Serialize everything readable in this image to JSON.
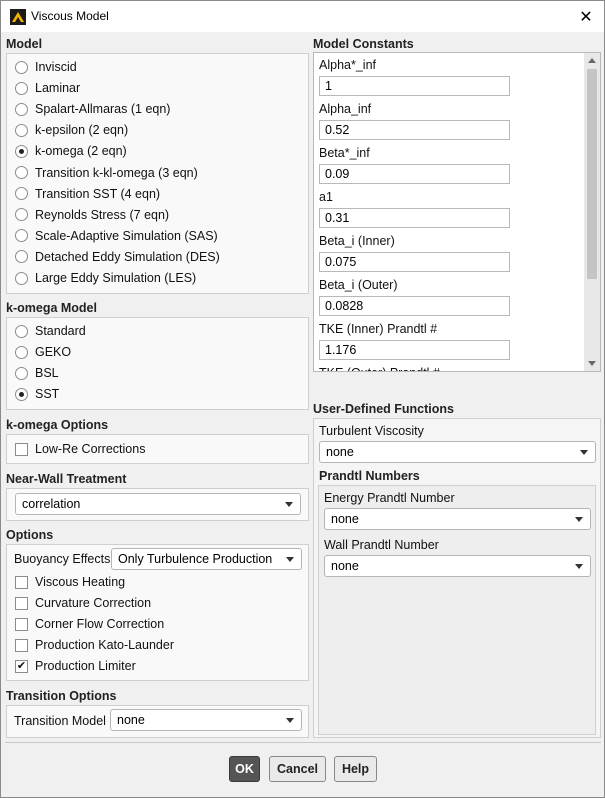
{
  "window": {
    "title": "Viscous Model",
    "close_glyph": "✕",
    "icon": "app-icon"
  },
  "model": {
    "title": "Model",
    "options": [
      {
        "label": "Inviscid",
        "selected": false
      },
      {
        "label": "Laminar",
        "selected": false
      },
      {
        "label": "Spalart-Allmaras (1 eqn)",
        "selected": false
      },
      {
        "label": "k-epsilon (2 eqn)",
        "selected": false
      },
      {
        "label": "k-omega (2 eqn)",
        "selected": true
      },
      {
        "label": "Transition k-kl-omega (3 eqn)",
        "selected": false
      },
      {
        "label": "Transition SST (4 eqn)",
        "selected": false
      },
      {
        "label": "Reynolds Stress (7 eqn)",
        "selected": false
      },
      {
        "label": "Scale-Adaptive Simulation (SAS)",
        "selected": false
      },
      {
        "label": "Detached Eddy Simulation (DES)",
        "selected": false
      },
      {
        "label": "Large Eddy Simulation (LES)",
        "selected": false
      }
    ]
  },
  "komega_model": {
    "title": "k-omega Model",
    "options": [
      {
        "label": "Standard",
        "selected": false
      },
      {
        "label": "GEKO",
        "selected": false
      },
      {
        "label": "BSL",
        "selected": false
      },
      {
        "label": "SST",
        "selected": true
      }
    ]
  },
  "komega_options": {
    "title": "k-omega Options",
    "low_re": {
      "label": "Low-Re Corrections",
      "checked": false
    }
  },
  "near_wall": {
    "title": "Near-Wall Treatment",
    "value": "correlation"
  },
  "options": {
    "title": "Options",
    "buoyancy_label": "Buoyancy Effects",
    "buoyancy_value": "Only Turbulence Production",
    "checks": [
      {
        "label": "Viscous Heating",
        "checked": false
      },
      {
        "label": "Curvature Correction",
        "checked": false
      },
      {
        "label": "Corner Flow Correction",
        "checked": false
      },
      {
        "label": "Production Kato-Launder",
        "checked": false
      },
      {
        "label": "Production Limiter",
        "checked": true
      }
    ]
  },
  "transition": {
    "title": "Transition Options",
    "model_label": "Transition Model",
    "model_value": "none"
  },
  "constants": {
    "title": "Model Constants",
    "items": [
      {
        "label": "Alpha*_inf",
        "value": "1"
      },
      {
        "label": "Alpha_inf",
        "value": "0.52"
      },
      {
        "label": "Beta*_inf",
        "value": "0.09"
      },
      {
        "label": "a1",
        "value": "0.31"
      },
      {
        "label": "Beta_i (Inner)",
        "value": "0.075"
      },
      {
        "label": "Beta_i (Outer)",
        "value": "0.0828"
      },
      {
        "label": "TKE (Inner) Prandtl #",
        "value": "1.176"
      },
      {
        "label": "TKE (Outer) Prandtl #",
        "value": ""
      }
    ]
  },
  "udf": {
    "title": "User-Defined Functions",
    "turb_visc_label": "Turbulent Viscosity",
    "turb_visc_value": "none",
    "prandtl_title": "Prandtl Numbers",
    "energy_label": "Energy Prandtl Number",
    "energy_value": "none",
    "wall_label": "Wall Prandtl Number",
    "wall_value": "none"
  },
  "buttons": {
    "ok": "OK",
    "cancel": "Cancel",
    "help": "Help"
  }
}
